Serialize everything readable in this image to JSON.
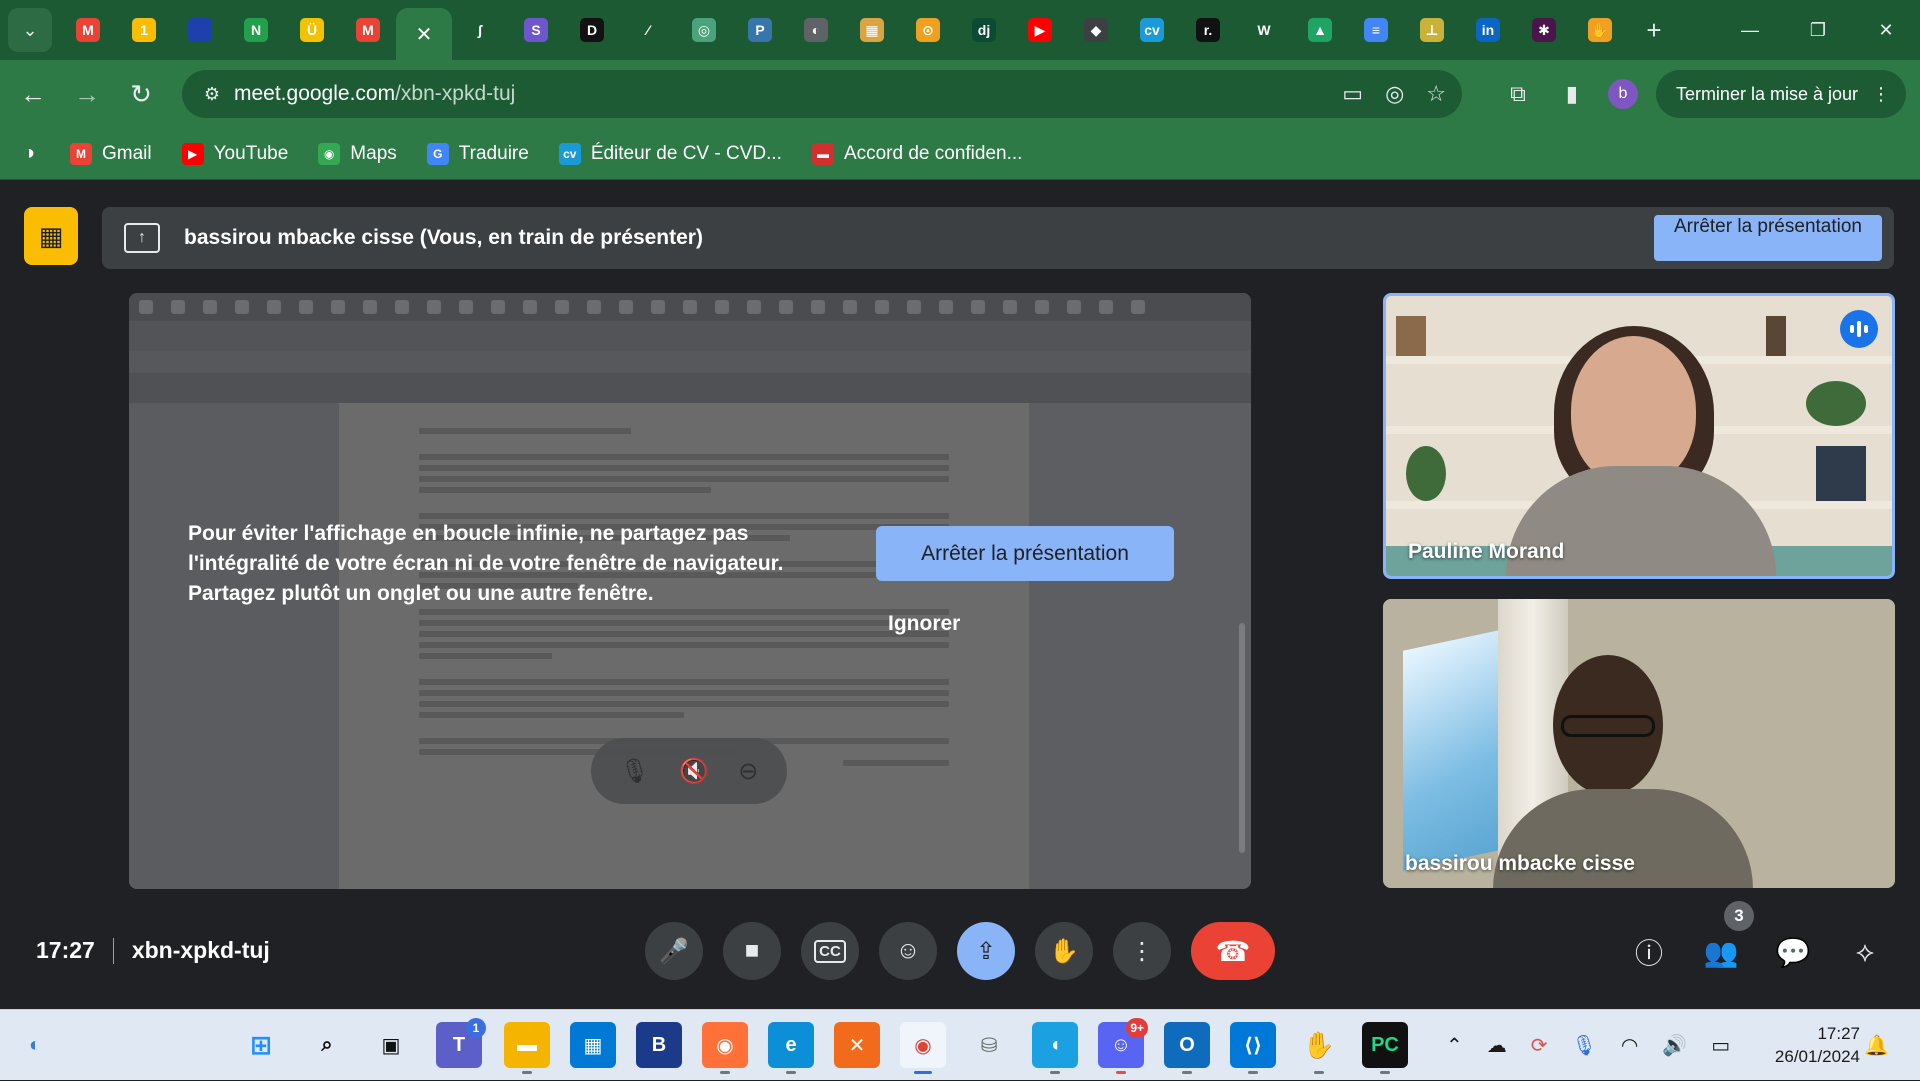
{
  "browser": {
    "tabs": [
      {
        "icon": "gmail-icon",
        "label": "M",
        "color": "#ea4335"
      },
      {
        "icon": "google-maps-icon",
        "label": "1",
        "color": "#fbbc04"
      },
      {
        "icon": "france-flag-icon",
        "label": "",
        "color": "#1e40af"
      },
      {
        "icon": "green-app-icon",
        "label": "N",
        "color": "#22a04b"
      },
      {
        "icon": "yellow-circle-icon",
        "label": "Ü",
        "color": "#f2c200"
      },
      {
        "icon": "gmail-icon",
        "label": "M",
        "color": "#ea4335"
      },
      {
        "icon": "close-tab-icon",
        "label": "✕",
        "color": "#2d7a47",
        "active": true
      },
      {
        "icon": "script-icon",
        "label": "ʃ",
        "color": "#1c5a34"
      },
      {
        "icon": "purple-s-icon",
        "label": "S",
        "color": "#6e56cf"
      },
      {
        "icon": "d-icon",
        "label": "D",
        "color": "#111111"
      },
      {
        "icon": "feather-icon",
        "label": "⁄",
        "color": "#1c5a34"
      },
      {
        "icon": "chatgpt-icon",
        "label": "◎",
        "color": "#4aa37a"
      },
      {
        "icon": "python-icon",
        "label": "P",
        "color": "#3776ab"
      },
      {
        "icon": "globe-icon",
        "label": "◐",
        "color": "#5f6368"
      },
      {
        "icon": "image-icon",
        "label": "▦",
        "color": "#d9a441"
      },
      {
        "icon": "headset-icon",
        "label": "⊙",
        "color": "#f0a020"
      },
      {
        "icon": "dj-icon",
        "label": "dj",
        "color": "#0c4b33"
      },
      {
        "icon": "youtube-icon",
        "label": "▶",
        "color": "#ff0000"
      },
      {
        "icon": "diamond-icon",
        "label": "◆",
        "color": "#3c4043"
      },
      {
        "icon": "cv-icon",
        "label": "cv",
        "color": "#1a9bd7"
      },
      {
        "icon": "r-icon",
        "label": "r.",
        "color": "#111111"
      },
      {
        "icon": "w-icon",
        "label": "W",
        "color": "#1c5a34"
      },
      {
        "icon": "google-drive-icon",
        "label": "▲",
        "color": "#1fa463"
      },
      {
        "icon": "google-docs-icon",
        "label": "≡",
        "color": "#4285f4"
      },
      {
        "icon": "stamp-icon",
        "label": "⊥",
        "color": "#c9b23a"
      },
      {
        "icon": "linkedin-icon",
        "label": "in",
        "color": "#0a66c2"
      },
      {
        "icon": "slack-icon",
        "label": "✱",
        "color": "#4a154b"
      },
      {
        "icon": "hand-icon",
        "label": "✋",
        "color": "#f0a020"
      }
    ],
    "url_host": "meet.google.com",
    "url_path": "/xbn-xpkd-tuj",
    "update_label": "Terminer la mise à jour",
    "profile_initial": "b",
    "bookmarks": [
      {
        "icon": "gmail-icon",
        "label": "Gmail",
        "color": "#ea4335",
        "glyph": "M"
      },
      {
        "icon": "youtube-icon",
        "label": "YouTube",
        "color": "#ff0000",
        "glyph": "▶"
      },
      {
        "icon": "maps-icon",
        "label": "Maps",
        "color": "#34a853",
        "glyph": "◉"
      },
      {
        "icon": "translate-icon",
        "label": "Traduire",
        "color": "#4285f4",
        "glyph": "G"
      },
      {
        "icon": "cv-icon",
        "label": "Éditeur de CV - CVD...",
        "color": "#1a9bd7",
        "glyph": "cv"
      },
      {
        "icon": "document-icon",
        "label": "Accord de confiden...",
        "color": "#d32f2f",
        "glyph": "▬"
      }
    ]
  },
  "meet": {
    "presenting_text": "bassirou mbacke cisse (Vous, en train de présenter)",
    "stop_presenting_top": "Arrêter la présentation",
    "warning_text": "Pour éviter l'affichage en boucle infinie, ne partagez pas l'intégralité de votre écran ni de votre fenêtre de navigateur. Partagez plutôt un onglet ou une autre fenêtre.",
    "warning_stop": "Arrêter la présentation",
    "warning_ignore": "Ignorer",
    "participants": [
      {
        "name": "Pauline Morand",
        "speaking": true
      },
      {
        "name": "bassirou mbacke cisse",
        "speaking": false
      }
    ],
    "time": "17:27",
    "meeting_code": "xbn-xpkd-tuj",
    "participant_count": "3",
    "controls": [
      "microphone-icon",
      "camera-icon",
      "captions-icon",
      "emoji-icon",
      "present-icon",
      "raise-hand-icon",
      "more-options-icon",
      "end-call-icon"
    ]
  },
  "taskbar": {
    "time": "17:27",
    "date": "26/01/2024",
    "teams_badge": "1",
    "discord_badge": "9+"
  }
}
